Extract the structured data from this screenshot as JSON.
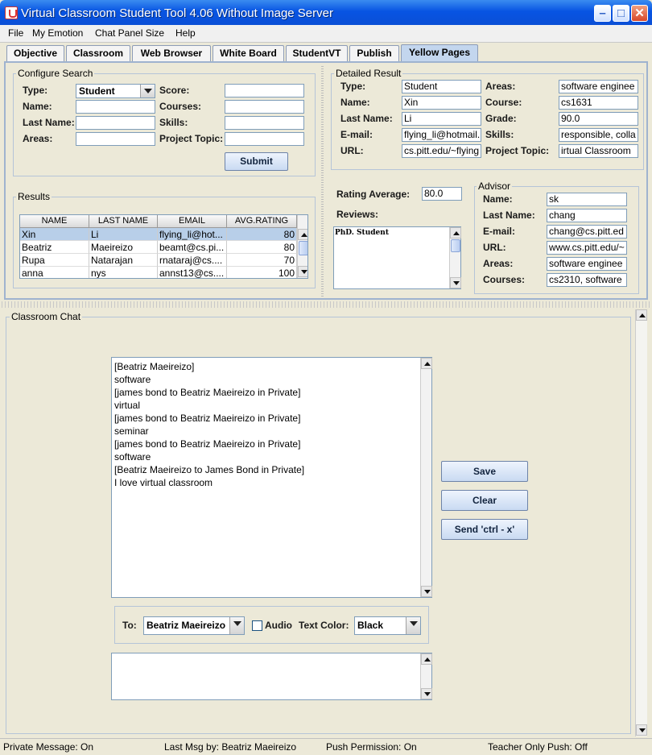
{
  "window": {
    "title": "Virtual Classroom Student Tool 4.06 Without Image Server"
  },
  "menubar": [
    "File",
    "My Emotion",
    "Chat Panel Size",
    "Help"
  ],
  "tabs": [
    "Objective",
    "Classroom",
    "Web Browser",
    "White Board",
    "StudentVT",
    "Publish",
    "Yellow Pages"
  ],
  "active_tab": "Yellow Pages",
  "configure_search": {
    "title": "Configure Search",
    "type_label": "Type:",
    "type_value": "Student",
    "score_label": "Score:",
    "name_label": "Name:",
    "courses_label": "Courses:",
    "lastname_label": "Last Name:",
    "skills_label": "Skills:",
    "areas_label": "Areas:",
    "project_label": "Project Topic:",
    "submit_label": "Submit"
  },
  "results": {
    "title": "Results",
    "columns": [
      "NAME",
      "LAST NAME",
      "EMAIL",
      "AVG.RATING"
    ],
    "rows": [
      [
        "Xin",
        "Li",
        "flying_li@hot...",
        "80"
      ],
      [
        "Beatriz",
        "Maeireizo",
        "beamt@cs.pi...",
        "80"
      ],
      [
        "Rupa",
        "Natarajan",
        "rnataraj@cs....",
        "70"
      ],
      [
        "anna",
        "nys",
        "annst13@cs....",
        "100"
      ]
    ]
  },
  "detailed_result": {
    "title": "Detailed Result",
    "type_label": "Type:",
    "type_value": "Student",
    "areas_label": "Areas:",
    "areas_value": "software enginee",
    "name_label": "Name:",
    "name_value": "Xin",
    "course_label": "Course:",
    "course_value": "cs1631",
    "lastname_label": "Last Name:",
    "lastname_value": "Li",
    "grade_label": "Grade:",
    "grade_value": "90.0",
    "email_label": "E-mail:",
    "email_value": "flying_li@hotmail.",
    "skills_label": "Skills:",
    "skills_value": "responsible, colla",
    "url_label": "URL:",
    "url_value": "cs.pitt.edu/~flying",
    "project_label": "Project Topic:",
    "project_value": "irtual Classroom"
  },
  "rating": {
    "label": "Rating Average:",
    "value": "80.0",
    "reviews_label": "Reviews:",
    "review_text": "PhD. Student"
  },
  "advisor": {
    "title": "Advisor",
    "name_label": "Name:",
    "name_value": "sk",
    "lastname_label": "Last Name:",
    "lastname_value": "chang",
    "email_label": "E-mail:",
    "email_value": "chang@cs.pitt.ed",
    "url_label": "URL:",
    "url_value": "www.cs.pitt.edu/~",
    "areas_label": "Areas:",
    "areas_value": "software enginee",
    "courses_label": "Courses:",
    "courses_value": "cs2310, software"
  },
  "chat": {
    "title": "Classroom Chat",
    "lines": [
      "[Beatriz Maeireizo]",
      "software",
      "[james bond to Beatriz Maeireizo in Private]",
      "virtual",
      "[james bond to Beatriz Maeireizo in Private]",
      "seminar",
      "[james bond to Beatriz Maeireizo in Private]",
      "software",
      "[Beatriz Maeireizo to James Bond in Private]",
      "I love virtual classroom"
    ],
    "save_label": "Save",
    "clear_label": "Clear",
    "send_label": "Send 'ctrl - x'",
    "to_label": "To:",
    "to_value": "Beatriz Maeireizo",
    "audio_label": "Audio",
    "textcolor_label": "Text Color:",
    "textcolor_value": "Black"
  },
  "status": {
    "private": "Private Message: On",
    "lastmsg": "Last Msg by: Beatriz Maeireizo",
    "push": "Push Permission: On",
    "teacher": "Teacher Only Push: Off"
  }
}
